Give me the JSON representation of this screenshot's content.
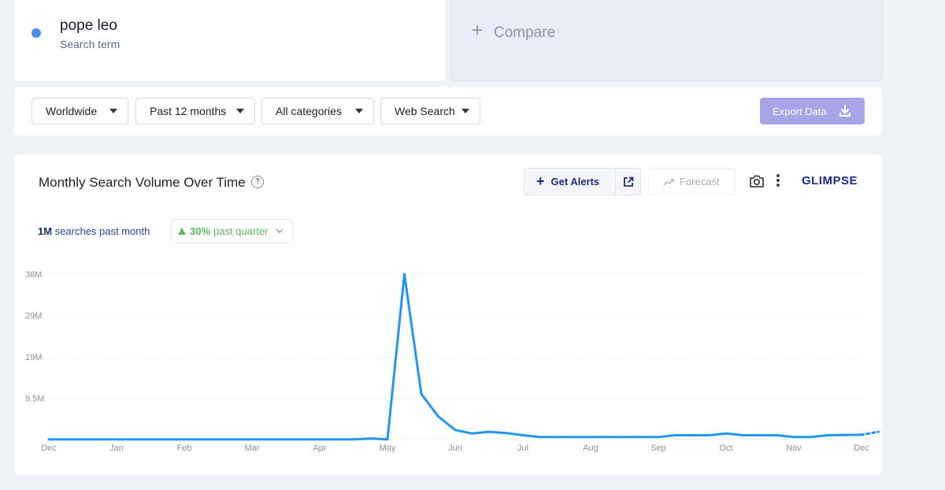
{
  "term": {
    "title": "pope leo",
    "subtitle": "Search term",
    "color": "#4f8ae8"
  },
  "compare": {
    "label": "Compare"
  },
  "filters": {
    "region": "Worldwide",
    "period": "Past 12 months",
    "category": "All categories",
    "search_type": "Web Search",
    "export_label": "Export Data"
  },
  "chart_header": {
    "title": "Monthly Search Volume Over Time",
    "alerts_label": "Get Alerts",
    "forecast_label": "Forecast",
    "brand": "GLIMPSE"
  },
  "stats": {
    "month_value": "1M",
    "month_label": "searches past month",
    "quarter_value": "30%",
    "quarter_label": "past quarter"
  },
  "colors": {
    "line": "#2196f3",
    "accent": "#a9a3e8",
    "brand": "#1b2a9c",
    "positive": "#5cb85c"
  },
  "chart_data": {
    "type": "line",
    "title": "Monthly Search Volume Over Time",
    "y_ticks": [
      {
        "label": "38M",
        "value": 38000000
      },
      {
        "label": "29M",
        "value": 28500000
      },
      {
        "label": "19M",
        "value": 19000000
      },
      {
        "label": "9.5M",
        "value": 9500000
      }
    ],
    "ylim": [
      0,
      38000000
    ],
    "x_ticks": [
      "Dec",
      "Jan",
      "Feb",
      "Mar",
      "Apr",
      "May",
      "Jun",
      "Jul",
      "Aug",
      "Sep",
      "Oct",
      "Nov",
      "Dec"
    ],
    "xlim": [
      0,
      12
    ],
    "grid": true,
    "series": [
      {
        "values": [
          [
            0,
            0.05
          ],
          [
            0.5,
            0.05
          ],
          [
            1,
            0.05
          ],
          [
            2,
            0.05
          ],
          [
            3,
            0.05
          ],
          [
            4,
            0.05
          ],
          [
            4.5,
            0.05
          ],
          [
            4.75,
            0.25
          ],
          [
            5.0,
            0.05
          ],
          [
            5.25,
            38.0
          ],
          [
            5.5,
            10.5
          ],
          [
            5.75,
            5.3
          ],
          [
            6.0,
            2.2
          ],
          [
            6.25,
            1.4
          ],
          [
            6.5,
            1.8
          ],
          [
            6.75,
            1.5
          ],
          [
            7.0,
            1.0
          ],
          [
            7.25,
            0.6
          ],
          [
            8.0,
            0.6
          ],
          [
            9.0,
            0.6
          ],
          [
            9.25,
            1.0
          ],
          [
            9.75,
            1.0
          ],
          [
            10.0,
            1.4
          ],
          [
            10.25,
            1.0
          ],
          [
            10.75,
            1.0
          ],
          [
            11.0,
            0.6
          ],
          [
            11.25,
            0.6
          ],
          [
            11.5,
            1.0
          ],
          [
            12.0,
            1.1
          ]
        ],
        "forecast": [
          [
            12.0,
            1.1
          ],
          [
            12.25,
            1.8
          ]
        ],
        "unit": "millions"
      }
    ]
  }
}
